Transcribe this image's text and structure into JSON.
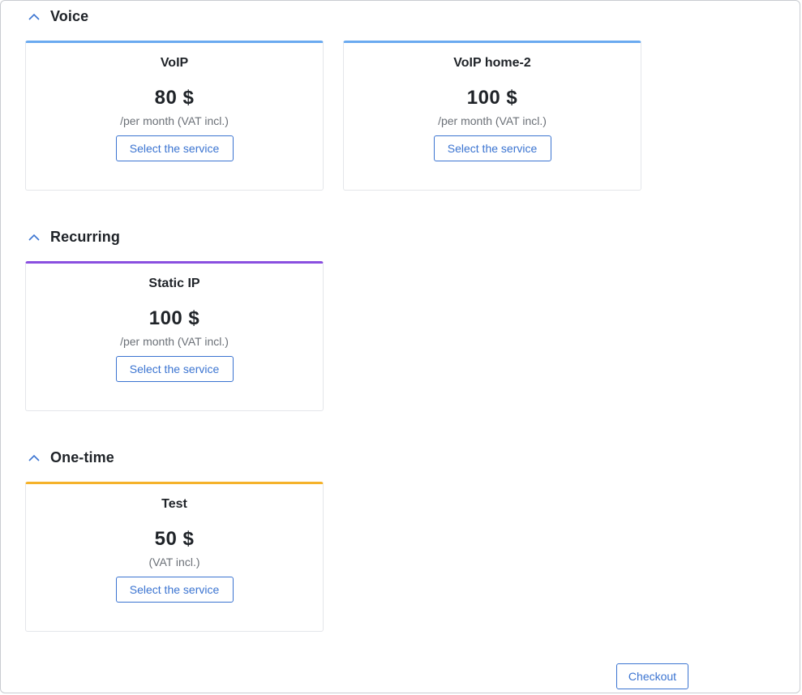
{
  "colors": {
    "primary": "#3b74d1",
    "voice_accent": "#6aaaf0",
    "recurring_accent": "#8a4fe0",
    "onetime_accent": "#f5b22a"
  },
  "sections": [
    {
      "title": "Voice",
      "icon": "chevron-up-icon",
      "cards": [
        {
          "title": "VoIP",
          "price": "80 $",
          "note": "/per month (VAT incl.)",
          "button": "Select the service"
        },
        {
          "title": "VoIP home-2",
          "price": "100 $",
          "note": "/per month (VAT incl.)",
          "button": "Select the service"
        }
      ]
    },
    {
      "title": "Recurring",
      "icon": "chevron-up-icon",
      "cards": [
        {
          "title": "Static IP",
          "price": "100 $",
          "note": "/per month (VAT incl.)",
          "button": "Select the service"
        }
      ]
    },
    {
      "title": "One-time",
      "icon": "chevron-up-icon",
      "cards": [
        {
          "title": "Test",
          "price": "50 $",
          "note": "(VAT incl.)",
          "button": "Select the service"
        }
      ]
    }
  ],
  "footer": {
    "checkout_label": "Checkout"
  }
}
